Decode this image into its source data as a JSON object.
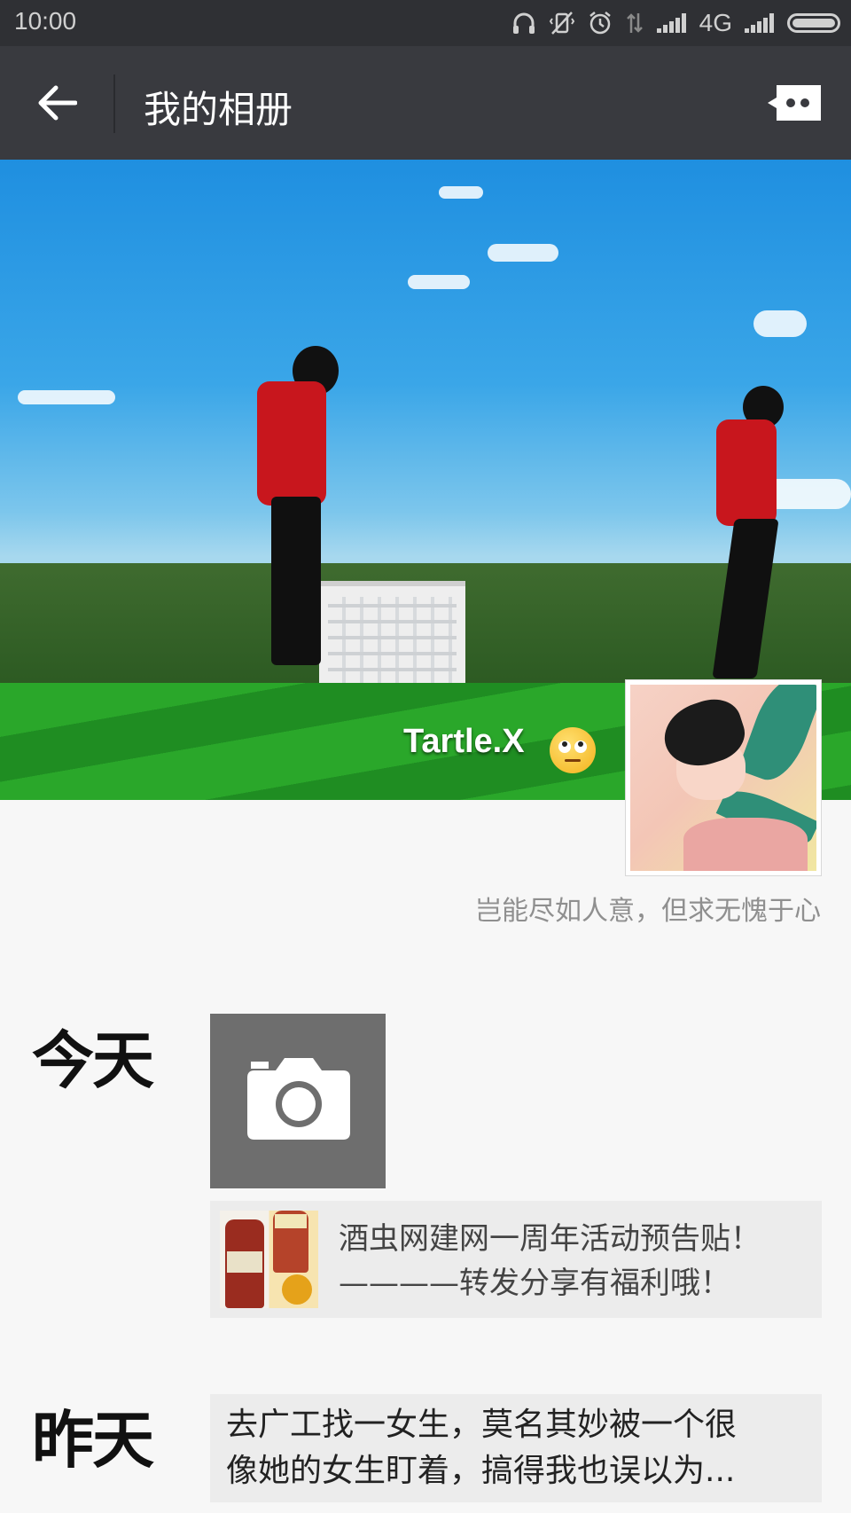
{
  "status_bar": {
    "time": "10:00",
    "network": "4G",
    "icons": [
      "headphones-icon",
      "vibrate-off-icon",
      "alarm-icon",
      "data-arrows-icon",
      "signal-icon",
      "signal-icon",
      "battery-icon"
    ]
  },
  "header": {
    "title": "我的相册",
    "back_icon": "arrow-left-icon",
    "more_icon": "message-more-icon"
  },
  "profile": {
    "name": "Tartle.X",
    "emoji": "face-with-rolling-eyes",
    "signature": "岂能尽如人意，但求无愧于心"
  },
  "timeline": [
    {
      "day": "今天",
      "has_camera_tile": true,
      "posts": [
        {
          "line1": "酒虫网建网一周年活动预告贴！",
          "line2": "————转发分享有福利哦！",
          "has_thumbnail": true
        }
      ]
    },
    {
      "day": "昨天",
      "posts": [
        {
          "line1": "去广工找一女生，莫名其妙被一个很",
          "line2": "像她的女生盯着，搞得我也误以为...",
          "has_thumbnail": false
        }
      ]
    }
  ],
  "colors": {
    "status_bar_bg": "#2f3034",
    "app_bar_bg": "#393a3f",
    "page_bg": "#f7f7f7",
    "post_bg": "#ececec",
    "camera_tile_bg": "#6e6e6e"
  }
}
